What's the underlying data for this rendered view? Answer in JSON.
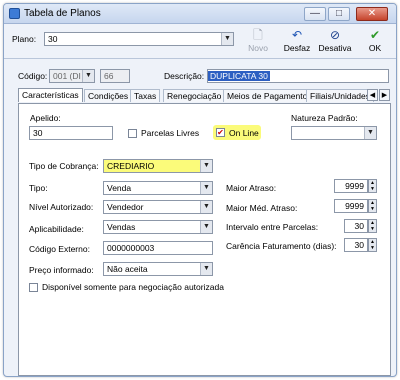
{
  "window": {
    "title": "Tabela de Planos",
    "minimize": "—",
    "maximize": "□",
    "close": "✕"
  },
  "toolbar": {
    "plano_label": "Plano:",
    "plano_value": "30",
    "novo": "Novo",
    "desfaz": "Desfaz",
    "desativa": "Desativa",
    "ok": "OK"
  },
  "header": {
    "codigo_label": "Código:",
    "codigo_combo": "001 (DI",
    "codigo_value": "66",
    "descricao_label": "Descrição:",
    "descricao_value": "DUPLICATA 30"
  },
  "tabs": [
    {
      "label": "Características"
    },
    {
      "label": "Condições"
    },
    {
      "label": "Taxas"
    },
    {
      "label": "Renegociação"
    },
    {
      "label": "Meios de Pagamento"
    },
    {
      "label": "Filiais/Unidades"
    }
  ],
  "form": {
    "apelido_label": "Apelido:",
    "apelido_value": "30",
    "parcelas_livres": "Parcelas Livres",
    "on_line": "On Line",
    "on_line_checked": "✔",
    "natureza_label": "Natureza Padrão:",
    "natureza_value": "",
    "tipo_cobranca_label": "Tipo de Cobrança:",
    "tipo_cobranca_value": "CREDIARIO",
    "tipo_label": "Tipo:",
    "tipo_value": "Venda",
    "nivel_label": "Nível Autorizado:",
    "nivel_value": "Vendedor",
    "aplicabilidade_label": "Aplicabilidade:",
    "aplicabilidade_value": "Vendas",
    "codigo_externo_label": "Código Externo:",
    "codigo_externo_value": "0000000003",
    "preco_label": "Preço informado:",
    "preco_value": "Não aceita",
    "disponivel_label": "Disponível somente para negociação autorizada",
    "maior_atraso_label": "Maior Atraso:",
    "maior_atraso_value": "9999",
    "maior_med_label": "Maior Méd. Atraso:",
    "maior_med_value": "9999",
    "intervalo_label": "Intervalo entre Parcelas:",
    "intervalo_value": "30",
    "carencia_label": "Carência Faturamento (dias):",
    "carencia_value": "30"
  },
  "icons": {
    "app": "window-app-icon",
    "novo": "new-document-icon",
    "desfaz": "undo-icon",
    "desativa": "disable-icon",
    "ok": "checkmark-icon"
  },
  "colors": {
    "highlight": "#fbfb7a",
    "title_bar": "#c6d6ee",
    "panel_bg": "#ffffff"
  }
}
